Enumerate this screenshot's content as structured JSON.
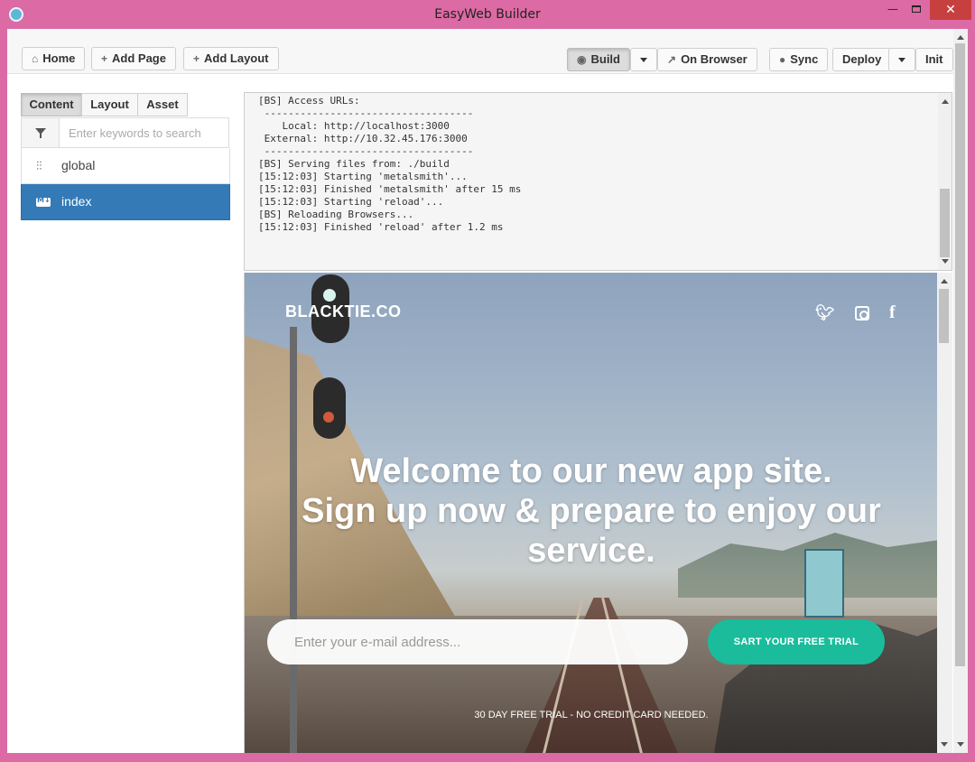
{
  "window": {
    "title": "EasyWeb Builder",
    "minimize": "—",
    "close": "✕"
  },
  "toolbar": {
    "home": "Home",
    "add_page": "Add Page",
    "add_layout": "Add Layout",
    "build": "Build",
    "on_browser": "On Browser",
    "sync": "Sync",
    "deploy": "Deploy",
    "init": "Init"
  },
  "sidebar": {
    "tabs": [
      {
        "label": "Content",
        "active": true
      },
      {
        "label": "Layout",
        "active": false
      },
      {
        "label": "Asset",
        "active": false
      }
    ],
    "search_placeholder": "Enter keywords to search",
    "items": [
      {
        "label": "global",
        "icon": "sliders-icon",
        "selected": false
      },
      {
        "label": "index",
        "icon": "markdown-icon",
        "selected": true
      }
    ]
  },
  "console": {
    "lines": [
      "[BS] Access URLs:",
      " -----------------------------------",
      "    Local: http://localhost:3000",
      " External: http://10.32.45.176:3000",
      " -----------------------------------",
      "[BS] Serving files from: ./build",
      "[15:12:03] Starting 'metalsmith'...",
      "[15:12:03] Finished 'metalsmith' after 15 ms",
      "[15:12:03] Starting 'reload'...",
      "[BS] Reloading Browsers...",
      "[15:12:03] Finished 'reload' after 1.2 ms"
    ]
  },
  "preview": {
    "brand": "BLACKTIE.CO",
    "social": [
      "twitter-icon",
      "instagram-icon",
      "facebook-icon"
    ],
    "headline_lines": [
      "Welcome to our new app site.",
      "Sign up now & prepare to enjoy our",
      "service."
    ],
    "email_placeholder": "Enter your e-mail address...",
    "cta": "SART YOUR FREE TRIAL",
    "fineprint": "30 DAY FREE TRIAL - NO CREDIT CARD NEEDED."
  },
  "colors": {
    "accent": "#1abc9c",
    "selected": "#337ab7",
    "frame": "#dc6aa4"
  }
}
